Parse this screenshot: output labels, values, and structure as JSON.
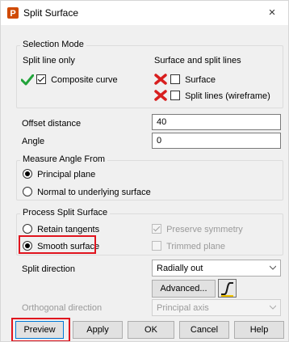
{
  "window": {
    "title": "Split Surface",
    "close_glyph": "×",
    "app_icon_letter": "P"
  },
  "selection_mode": {
    "legend": "Selection Mode",
    "split_line_only": "Split line only",
    "composite_curve": "Composite curve",
    "surface_and_split_lines": "Surface and split lines",
    "surface": "Surface",
    "split_lines": "Split lines (wireframe)"
  },
  "offset": {
    "label": "Offset distance",
    "value": "40"
  },
  "angle": {
    "label": "Angle",
    "value": "0"
  },
  "measure_angle": {
    "legend": "Measure Angle From",
    "principal_plane": "Principal plane",
    "normal_surface": "Normal to underlying surface"
  },
  "process": {
    "legend": "Process Split Surface",
    "retain_tangents": "Retain tangents",
    "preserve_symmetry": "Preserve symmetry",
    "smooth_surface": "Smooth surface",
    "trimmed_plane": "Trimmed plane"
  },
  "split_direction": {
    "label": "Split direction",
    "value": "Radially out",
    "advanced_label": "Advanced..."
  },
  "orthogonal_direction": {
    "label": "Orthogonal direction",
    "value": "Principal axis"
  },
  "footer": {
    "preview": "Preview",
    "apply": "Apply",
    "ok": "OK",
    "cancel": "Cancel",
    "help": "Help"
  },
  "colors": {
    "highlight": "#e0141e",
    "check_green": "#22a33a",
    "cross_red": "#d81e1e",
    "app_icon": "#d04a02"
  }
}
